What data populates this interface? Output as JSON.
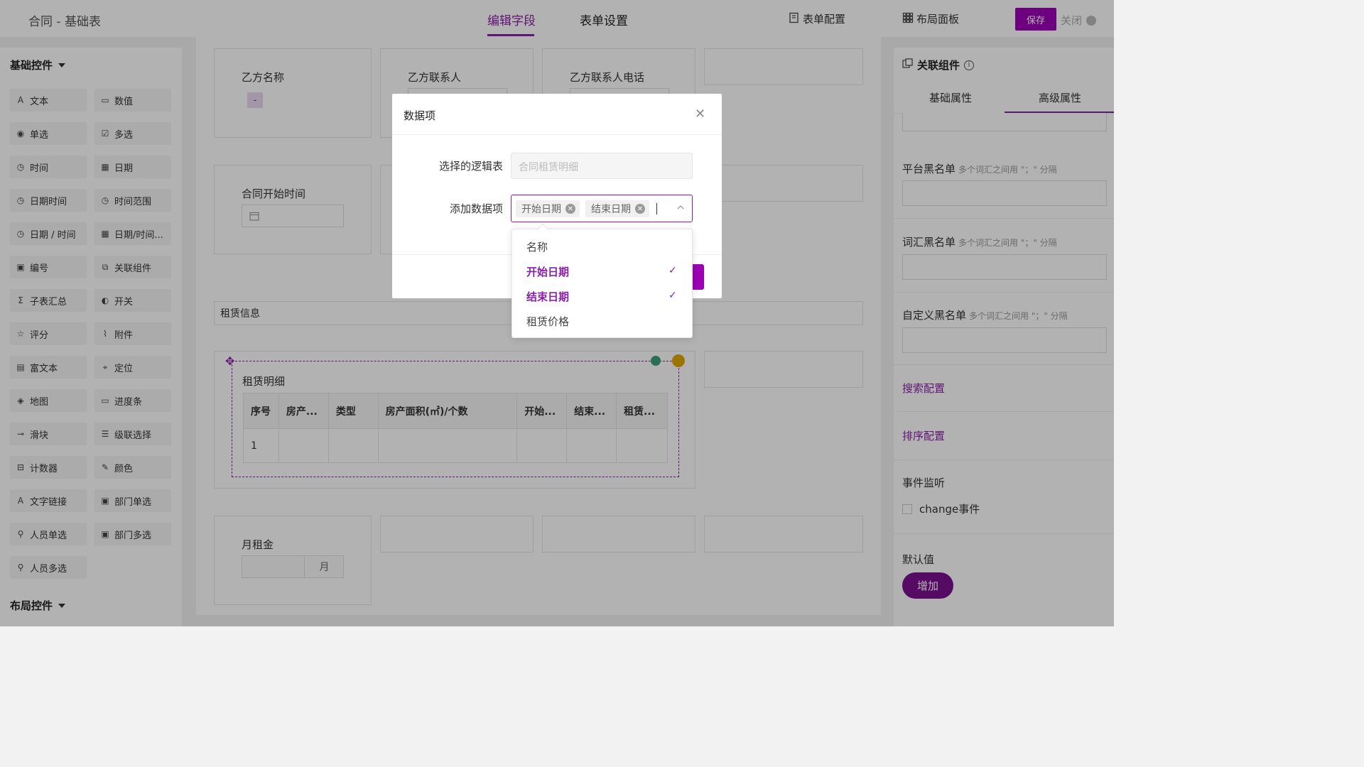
{
  "header": {
    "app_title": "合同 - 基础表",
    "tabs": [
      {
        "label": "编辑字段"
      },
      {
        "label": "表单设置"
      }
    ],
    "form_config": "表单配置",
    "layout_panel": "布局面板",
    "save": "保存",
    "close": "关闭"
  },
  "left_panel": {
    "basic_title": "基础控件",
    "layout_title": "布局控件",
    "controls": [
      {
        "label": "文本",
        "icon": "text-icon"
      },
      {
        "label": "数值",
        "icon": "number-icon"
      },
      {
        "label": "单选",
        "icon": "radio-icon"
      },
      {
        "label": "多选",
        "icon": "checkbox-icon"
      },
      {
        "label": "时间",
        "icon": "clock-icon"
      },
      {
        "label": "日期",
        "icon": "calendar-icon"
      },
      {
        "label": "日期时间",
        "icon": "clock-icon"
      },
      {
        "label": "时间范围",
        "icon": "clock-icon"
      },
      {
        "label": "日期 / 时间",
        "icon": "clock-icon"
      },
      {
        "label": "日期/时间...",
        "icon": "calendar-icon"
      },
      {
        "label": "编号",
        "icon": "serial-icon"
      },
      {
        "label": "关联组件",
        "icon": "link-icon"
      },
      {
        "label": "子表汇总",
        "icon": "sigma-icon"
      },
      {
        "label": "开关",
        "icon": "toggle-icon"
      },
      {
        "label": "评分",
        "icon": "star-icon"
      },
      {
        "label": "附件",
        "icon": "paperclip-icon"
      },
      {
        "label": "富文本",
        "icon": "richtext-icon"
      },
      {
        "label": "定位",
        "icon": "location-icon"
      },
      {
        "label": "地图",
        "icon": "map-icon"
      },
      {
        "label": "进度条",
        "icon": "progress-icon"
      },
      {
        "label": "滑块",
        "icon": "slider-icon"
      },
      {
        "label": "级联选择",
        "icon": "cascade-icon"
      },
      {
        "label": "计数器",
        "icon": "counter-icon"
      },
      {
        "label": "颜色",
        "icon": "color-picker-icon"
      },
      {
        "label": "文字链接",
        "icon": "text-link-icon"
      },
      {
        "label": "部门单选",
        "icon": "department-icon"
      },
      {
        "label": "人员单选",
        "icon": "user-icon"
      },
      {
        "label": "部门多选",
        "icon": "department-icon"
      },
      {
        "label": "人员多选",
        "icon": "users-icon"
      }
    ]
  },
  "canvas": {
    "party_b_name": "乙方名称",
    "party_b_name_tag": "-",
    "party_b_contact": "乙方联系人",
    "party_b_phone": "乙方联系人电话",
    "contract_start": "合同开始时间",
    "lease_info": "租赁信息",
    "subtable_title": "租赁明细",
    "subtable_columns": [
      "序号",
      "房产...",
      "类型",
      "房产面积(㎡)/个数",
      "开始...",
      "结束...",
      "租赁..."
    ],
    "subtable_rows": [
      [
        "1",
        "",
        "",
        "",
        "",
        "",
        ""
      ]
    ],
    "monthly_rent": "月租金",
    "monthly_rent_unit": "月"
  },
  "right_panel": {
    "title": "关联组件",
    "tabs": [
      "基础属性",
      "高级属性"
    ],
    "platform_blacklist": "平台黑名单",
    "word_blacklist": "词汇黑名单",
    "custom_blacklist": "自定义黑名单",
    "blacklist_hint": "多个词汇之间用 \"；\" 分隔",
    "search_config": "搜索配置",
    "sort_config": "排序配置",
    "event_listen": "事件监听",
    "change_event": "change事件",
    "default_value": "默认值",
    "add": "增加"
  },
  "modal": {
    "title": "数据项",
    "logic_table_label": "选择的逻辑表",
    "logic_table_value": "合同租赁明细",
    "add_items_label": "添加数据项",
    "selected_tags": [
      "开始日期",
      "结束日期"
    ],
    "options": [
      {
        "label": "名称",
        "selected": false
      },
      {
        "label": "开始日期",
        "selected": true
      },
      {
        "label": "结束日期",
        "selected": true
      },
      {
        "label": "租赁价格",
        "selected": false
      }
    ]
  },
  "colors": {
    "accent": "#8a1fa8",
    "primary_button": "#9b00b5"
  }
}
